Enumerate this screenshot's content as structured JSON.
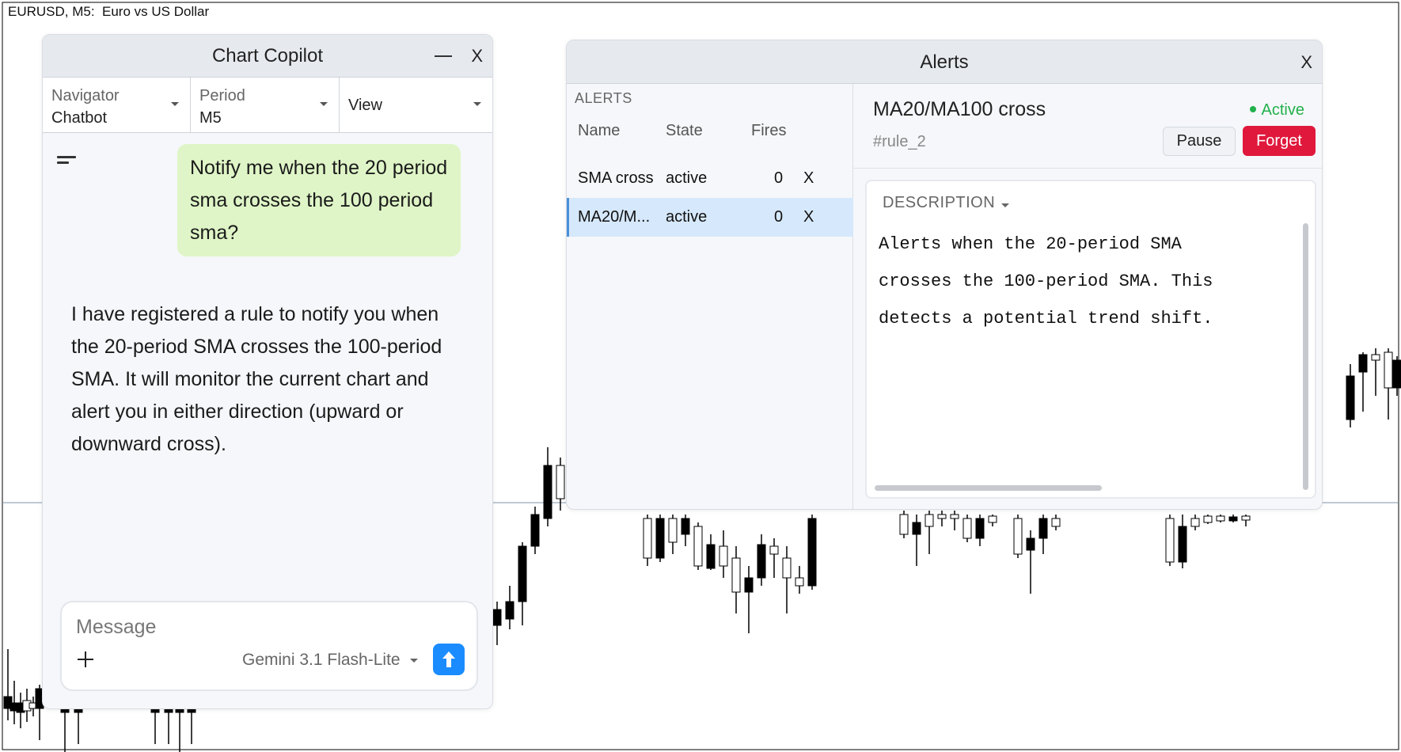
{
  "chart": {
    "title": "EURUSD, M5:  Euro vs US Dollar"
  },
  "copilot": {
    "title": "Chart Copilot",
    "minimize_label": "—",
    "close_label": "X",
    "navigator": {
      "label": "Navigator",
      "value": "Chatbot"
    },
    "period": {
      "label": "Period",
      "value": "M5"
    },
    "view": {
      "value": "View"
    },
    "messages": {
      "user": "Notify me when the 20 period sma crosses the 100 period sma?",
      "assistant": "I have registered a rule to notify you when the 20-period SMA crosses the 100-period SMA. It will monitor the current chart and alert you in either direction (upward or downward cross)."
    },
    "composer": {
      "placeholder": "Message",
      "model": "Gemini 3.1 Flash-Lite"
    }
  },
  "alerts": {
    "title": "Alerts",
    "close_label": "X",
    "section_label": "ALERTS",
    "columns": {
      "name": "Name",
      "state": "State",
      "fires": "Fires"
    },
    "rows": [
      {
        "name": "SMA cross",
        "state": "active",
        "fires": "0",
        "remove": "X"
      },
      {
        "name": "MA20/M...",
        "state": "active",
        "fires": "0",
        "remove": "X"
      }
    ],
    "detail": {
      "name": "MA20/MA100 cross",
      "rule_id": "#rule_2",
      "status": "Active",
      "pause_label": "Pause",
      "forget_label": "Forget",
      "description_label": "DESCRIPTION",
      "description": "Alerts when the 20-period SMA\ncrosses the 100-period SMA. This\ndetects a potential trend shift."
    }
  },
  "colors": {
    "accent_blue": "#1a8cff",
    "danger_red": "#e0183c",
    "status_green": "#22b14c",
    "user_bubble": "#dff5c7"
  }
}
